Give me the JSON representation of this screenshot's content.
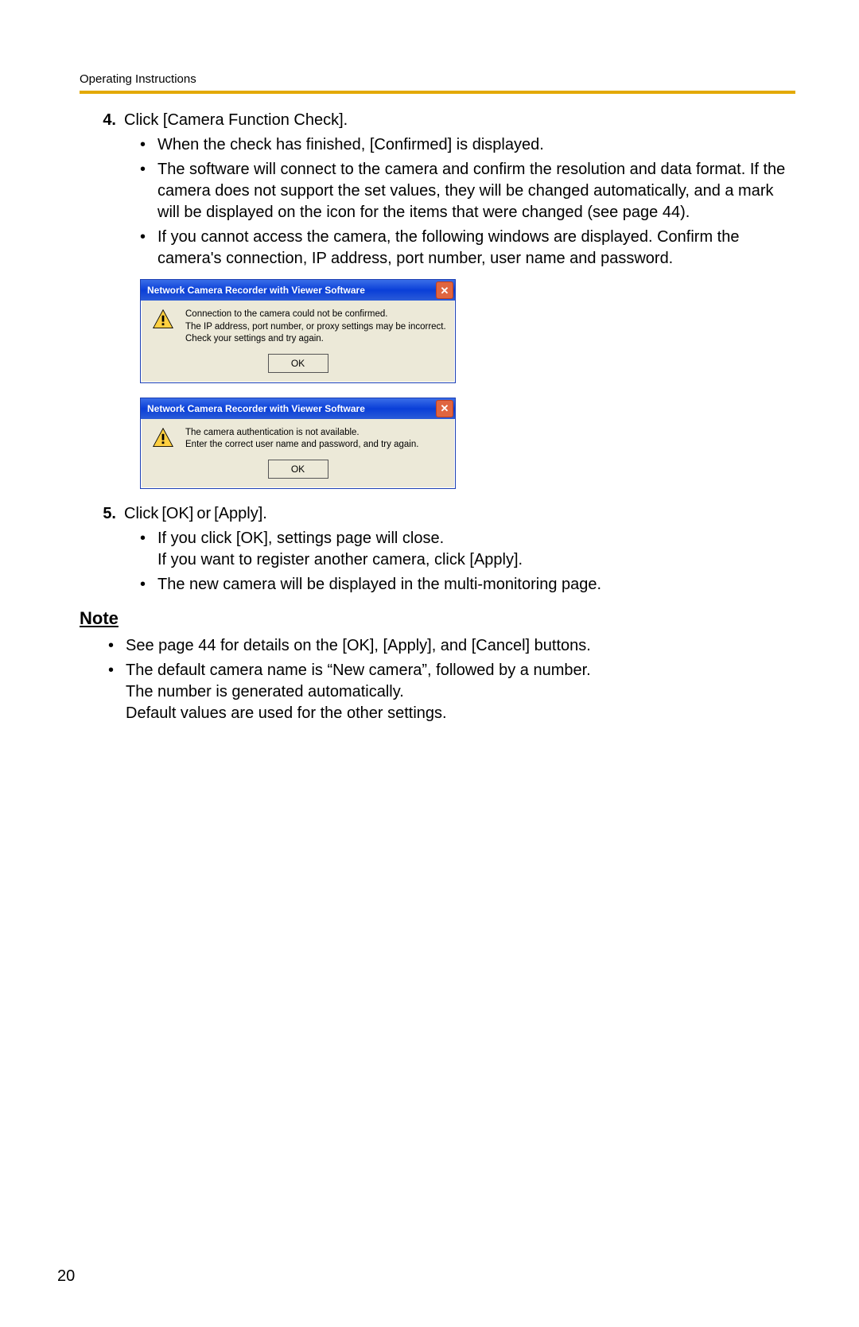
{
  "header": "Operating Instructions",
  "step4": {
    "num": "4.",
    "text": "Click [Camera Function Check].",
    "bullets": [
      "When the check has finished, [Confirmed] is displayed.",
      "The software will connect to the camera and confirm the resolution and data format. If the camera does not support the set values, they will be changed automatically, and a mark will be displayed on the icon for the items that were changed (see page 44).",
      "If you cannot access the camera, the following windows are displayed. Confirm the camera's connection, IP address, port number, user name and password."
    ]
  },
  "dialogs": [
    {
      "title": "Network Camera Recorder with Viewer Software",
      "lines": [
        "Connection to the camera could not be confirmed.",
        "The IP address, port number, or proxy settings may be incorrect.",
        "Check your settings and try again."
      ],
      "ok": "OK"
    },
    {
      "title": "Network Camera Recorder with Viewer Software",
      "lines": [
        "The camera authentication is not available.",
        "Enter the correct user name and password, and try again."
      ],
      "ok": "OK"
    }
  ],
  "step5": {
    "num": "5.",
    "text": "Click [OK] or [Apply].",
    "bullets": [
      "If you click [OK], settings page will close.\nIf you want to register another camera, click [Apply].",
      "The new camera will be displayed in the multi-monitoring page."
    ]
  },
  "note": {
    "heading": "Note",
    "bullets": [
      "See page 44 for details on the [OK], [Apply], and [Cancel] buttons.",
      "The default camera name is “New camera”, followed by a number.\nThe number is generated automatically.\nDefault values are used for the other settings."
    ]
  },
  "pagenum": "20"
}
